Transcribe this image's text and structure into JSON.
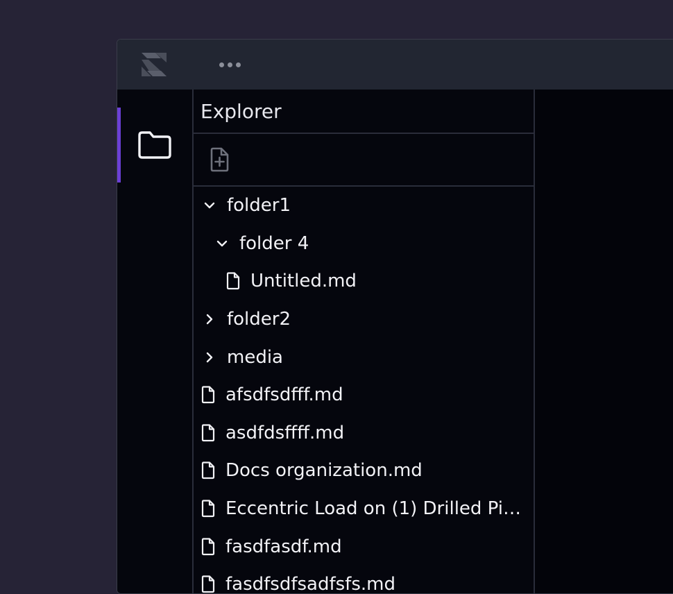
{
  "titlebar": {
    "logo_icon": "app-logo-icon",
    "more_icon": "more-horizontal-icon"
  },
  "activity_bar": {
    "items": [
      {
        "name": "explorer",
        "icon": "folder-icon",
        "active": true
      }
    ],
    "accent_color": "#6b3fd6"
  },
  "explorer": {
    "title": "Explorer",
    "toolbar": {
      "new_file_icon": "new-file-icon"
    },
    "tree": [
      {
        "type": "folder",
        "label": "folder1",
        "expanded": true,
        "depth": 0
      },
      {
        "type": "folder",
        "label": "folder 4",
        "expanded": true,
        "depth": 1
      },
      {
        "type": "file",
        "label": "Untitled.md",
        "depth": 2
      },
      {
        "type": "folder",
        "label": "folder2",
        "expanded": false,
        "depth": 0
      },
      {
        "type": "folder",
        "label": "media",
        "expanded": false,
        "depth": 0
      },
      {
        "type": "file",
        "label": "afsdfsdfff.md",
        "depth": 0
      },
      {
        "type": "file",
        "label": "asdfdsffff.md",
        "depth": 0
      },
      {
        "type": "file",
        "label": "Docs organization.md",
        "depth": 0
      },
      {
        "type": "file",
        "label": "Eccentric Load on (1) Drilled Pie...",
        "depth": 0
      },
      {
        "type": "file",
        "label": "fasdfasdf.md",
        "depth": 0
      },
      {
        "type": "file",
        "label": "fasdfsdfsadfsfs.md",
        "depth": 0
      }
    ]
  },
  "colors": {
    "desktop_bg": "#262336",
    "titlebar_bg": "#222632",
    "panel_bg": "#05060d",
    "border": "#2a2d3a",
    "text": "#f2f2f6"
  }
}
